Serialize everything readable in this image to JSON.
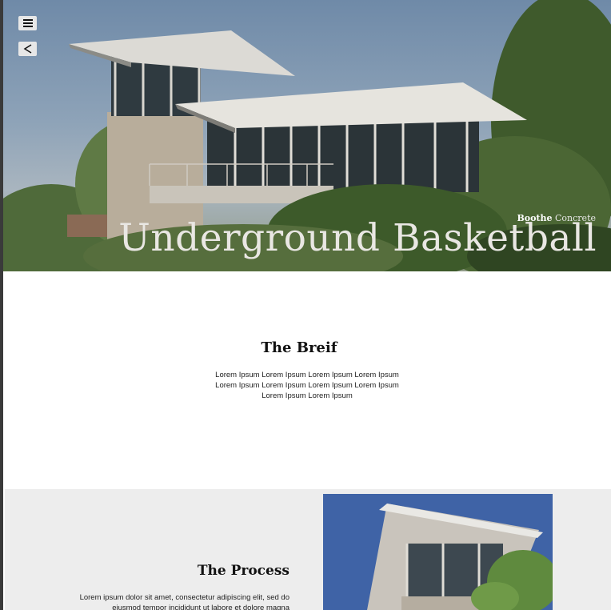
{
  "header": {
    "menu_icon": "hamburger-menu-icon",
    "back_icon": "chevron-left-icon",
    "brand_bold": "Boothe",
    "brand_light": "Concrete",
    "title": "Underground Basketball"
  },
  "brief": {
    "title": "The Breif",
    "body": "Lorem Ipsum Lorem Ipsum Lorem Ipsum Lorem Ipsum Lorem Ipsum Lorem Ipsum Lorem Ipsum Lorem Ipsum Lorem Ipsum Lorem Ipsum"
  },
  "process": {
    "title": "The Process",
    "body": "Lorem ipsum dolor sit amet, consectetur adipiscing elit, sed do eiusmod tempor incididunt ut labore et dolore magna"
  },
  "colors": {
    "page_background": "#ffffff",
    "process_background": "#ededed",
    "button_background": "#e7e7e7"
  }
}
